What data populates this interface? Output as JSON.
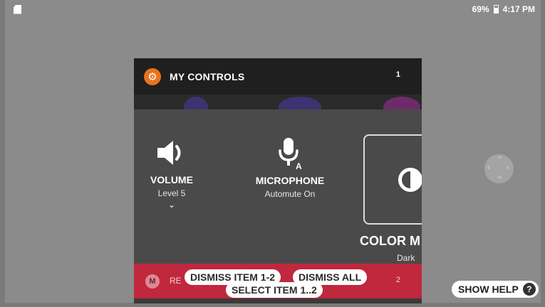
{
  "status_bar": {
    "battery": "69%",
    "time": "4:17 PM"
  },
  "panel": {
    "header_title": "MY CONTROLS",
    "header_count": "1",
    "tiles": {
      "volume": {
        "label": "VOLUME",
        "sub": "Level 5",
        "icon": "speaker-icon"
      },
      "microphone": {
        "label": "MICROPHONE",
        "sub": "Automute On",
        "icon": "microphone-auto-icon"
      },
      "color_mode": {
        "label": "COLOR M",
        "sub": "Dark",
        "icon": "contrast-icon"
      }
    },
    "next_item": {
      "text": "RE",
      "count": "2"
    }
  },
  "voice_hints": {
    "dismiss_item": "DISMISS ITEM 1-2",
    "dismiss_all": "DISMISS ALL",
    "select_item": "SELECT ITEM 1..2"
  },
  "show_help": {
    "label": "SHOW HELP",
    "icon_char": "?"
  },
  "colors": {
    "accent": "#e8731e",
    "alert": "#c0283d",
    "panel": "#4a4a4a",
    "header": "#1f1f1f"
  }
}
